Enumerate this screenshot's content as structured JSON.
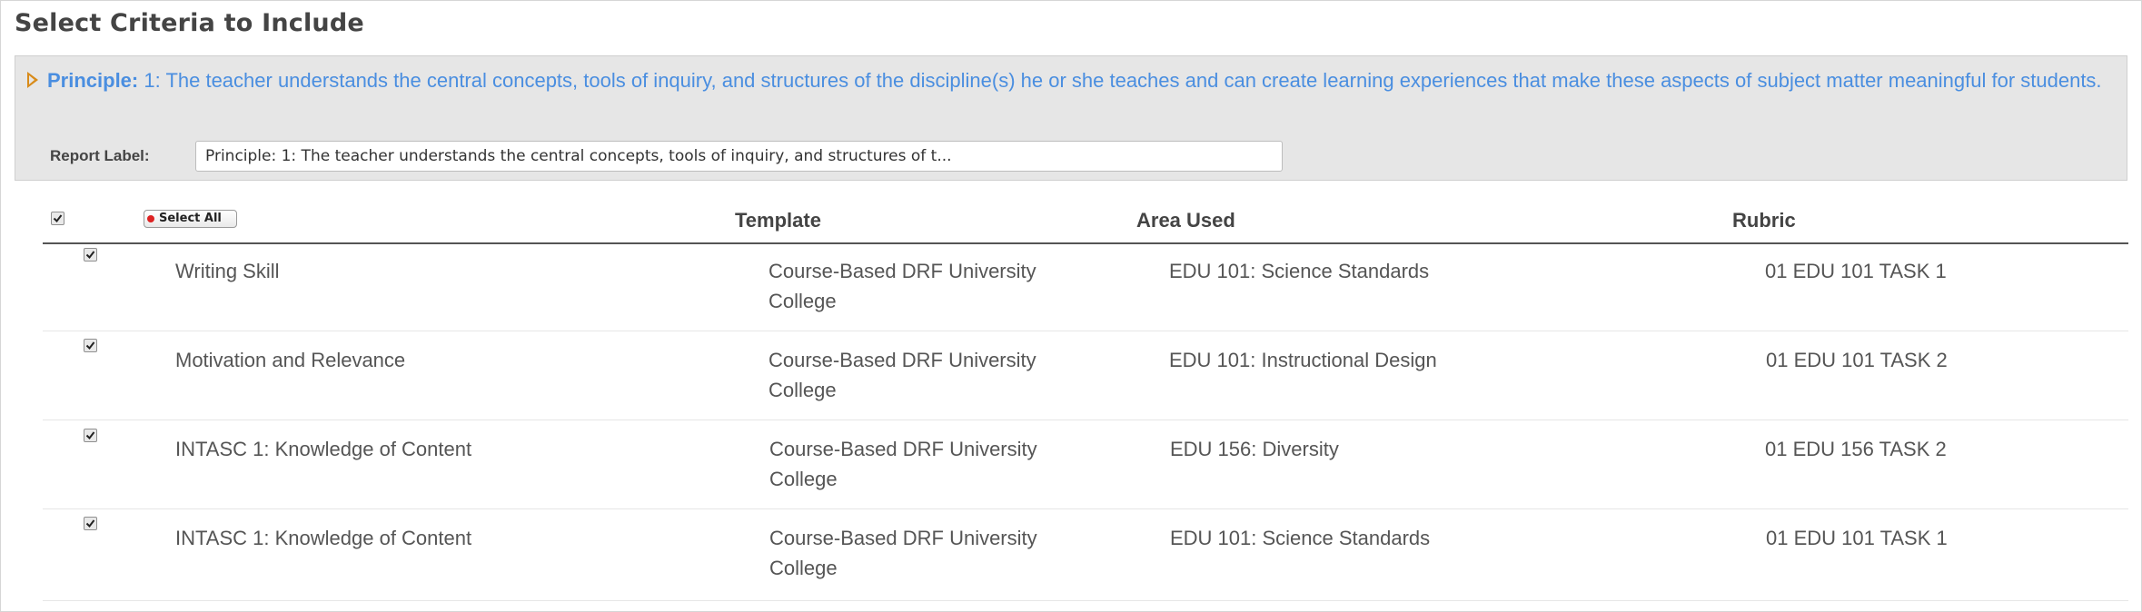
{
  "page": {
    "title": "Select Criteria to Include"
  },
  "principle": {
    "label": "Principle:",
    "text": "1: The teacher understands the central concepts, tools of inquiry, and structures of the discipline(s) he or she teaches and can create learning experiences that make these aspects of subject matter meaningful for students."
  },
  "report_label": {
    "label": "Report Label:",
    "value": "Principle: 1: The teacher understands the central concepts, tools of inquiry, and structures of t..."
  },
  "table": {
    "select_all_label": "Select All",
    "headers": {
      "template": "Template",
      "area_used": "Area Used",
      "rubric": "Rubric"
    },
    "rows": [
      {
        "name": "Writing Skill",
        "template_line1": "Course-Based DRF University",
        "template_line2": "College",
        "area_used": "EDU 101: Science Standards",
        "rubric": "01 EDU 101 TASK 1",
        "checked": true
      },
      {
        "name": "Motivation and Relevance",
        "template_line1": "Course-Based DRF University",
        "template_line2": "College",
        "area_used": "EDU 101: Instructional Design",
        "rubric": "01 EDU 101 TASK 2",
        "checked": true
      },
      {
        "name": "INTASC 1: Knowledge of Content",
        "template_line1": "Course-Based DRF University",
        "template_line2": "College",
        "area_used": "EDU 156: Diversity",
        "rubric": "01 EDU 156 TASK 2",
        "checked": true
      },
      {
        "name": "INTASC 1: Knowledge of Content",
        "template_line1": "Course-Based DRF University",
        "template_line2": "College",
        "area_used": "EDU 101: Science Standards",
        "rubric": "01 EDU 101 TASK 1",
        "checked": true
      }
    ]
  }
}
